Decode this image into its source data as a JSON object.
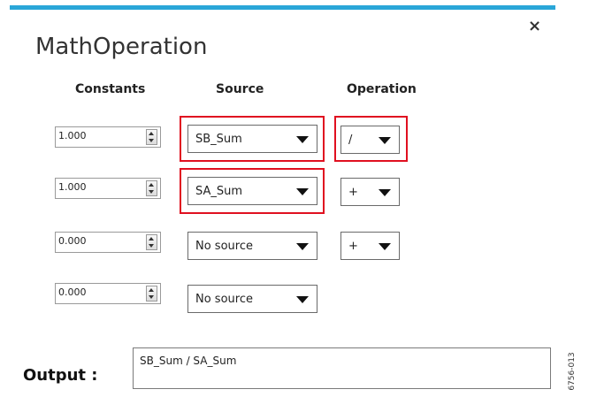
{
  "dialog": {
    "title": "MathOperation",
    "close_label": "×",
    "accent_color": "#2aa6d8",
    "highlight_color": "#e01020"
  },
  "headers": {
    "constants": "Constants",
    "source": "Source",
    "operation": "Operation"
  },
  "rows": [
    {
      "constant": "1.000",
      "source": "SB_Sum",
      "operation": "/",
      "source_highlighted": true,
      "operation_highlighted": true
    },
    {
      "constant": "1.000",
      "source": "SA_Sum",
      "operation": "+",
      "source_highlighted": true,
      "operation_highlighted": false
    },
    {
      "constant": "0.000",
      "source": "No source",
      "operation": "+",
      "source_highlighted": false,
      "operation_highlighted": false
    },
    {
      "constant": "0.000",
      "source": "No source",
      "operation": null,
      "source_highlighted": false,
      "operation_highlighted": false
    }
  ],
  "output": {
    "label": "Output :",
    "value": "SB_Sum / SA_Sum"
  },
  "figure_id": "6756-013",
  "icons": {
    "spin": "spinner-updown-icon",
    "dropdown": "chevron-down-icon",
    "close": "close-icon"
  }
}
